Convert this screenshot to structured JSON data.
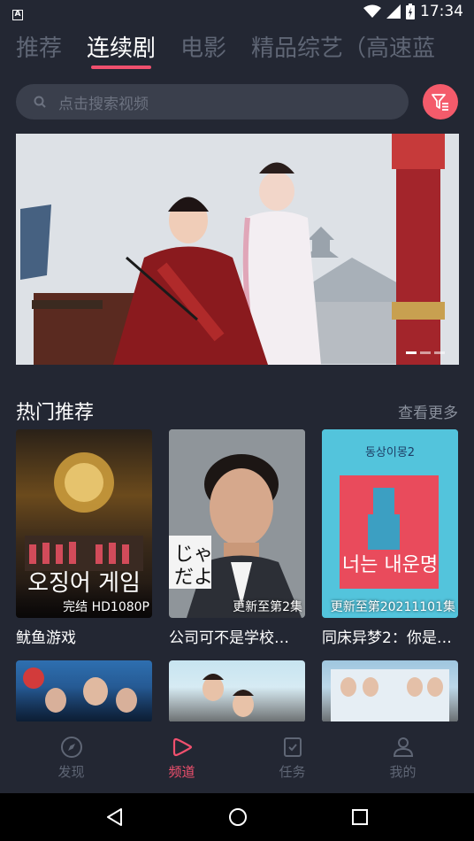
{
  "status_bar": {
    "time": "17:34"
  },
  "tabs": [
    {
      "label": "推荐"
    },
    {
      "label": "连续剧"
    },
    {
      "label": "电影"
    },
    {
      "label": "精品综艺（高速蓝"
    }
  ],
  "search": {
    "placeholder": "点击搜索视频"
  },
  "banner": {
    "slide_count": 3,
    "active_index": 0
  },
  "section": {
    "title": "热门推荐",
    "more": "查看更多"
  },
  "cards": [
    {
      "title": "鱿鱼游戏",
      "badge": "完结 HD1080P"
    },
    {
      "title": "公司可不是学校…",
      "badge": "更新至第2集"
    },
    {
      "title": "同床异梦2：你是…",
      "badge": "更新至第20211101集"
    }
  ],
  "bottom_nav": [
    {
      "label": "发现"
    },
    {
      "label": "频道"
    },
    {
      "label": "任务"
    },
    {
      "label": "我的"
    }
  ],
  "colors": {
    "accent": "#f0506e",
    "background": "#232733",
    "inactive": "#5f6675"
  }
}
